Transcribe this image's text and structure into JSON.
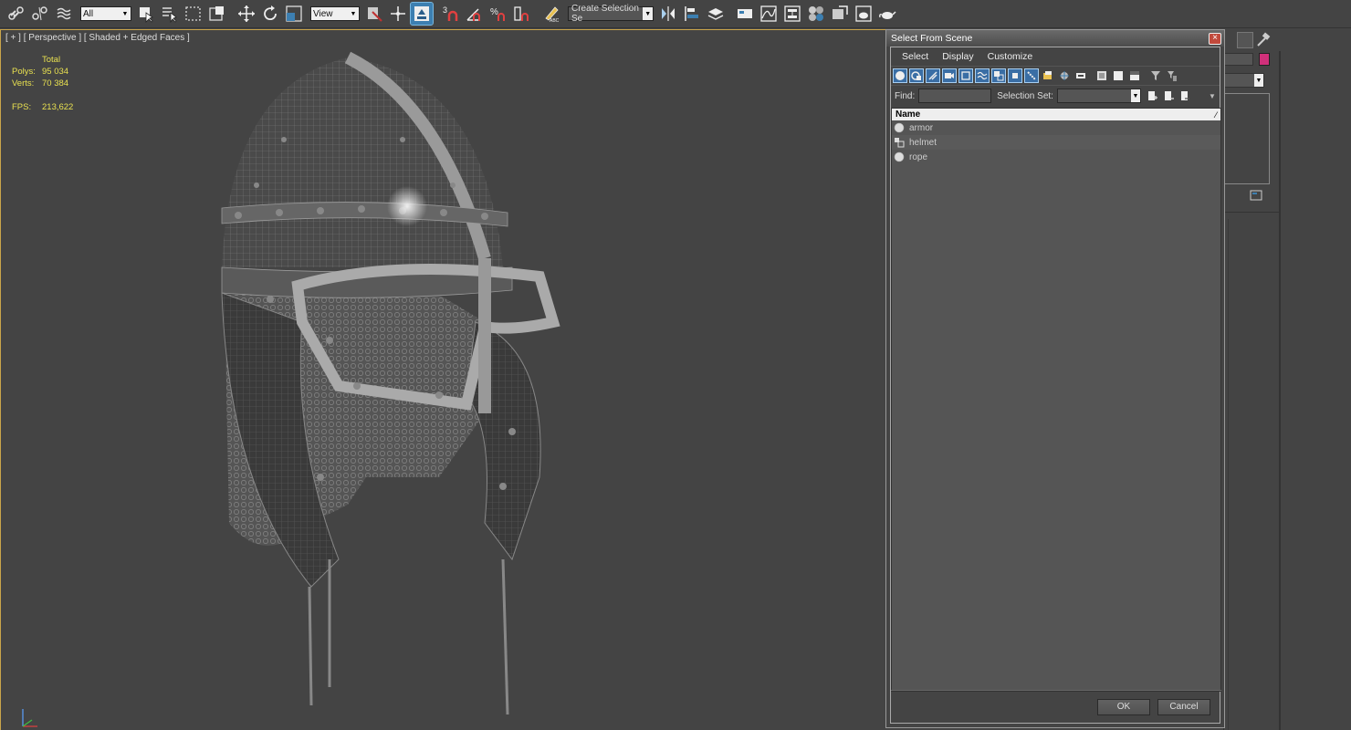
{
  "toolbar": {
    "selection_filter": "All",
    "reference_coord": "View",
    "named_selection_placeholder": "Create Selection Se",
    "snap_label": "3"
  },
  "viewport": {
    "label": "[ + ] [ Perspective ] [ Shaded + Edged Faces ]",
    "stats": {
      "total_label": "Total",
      "polys_label": "Polys:",
      "polys_value": "95 034",
      "verts_label": "Verts:",
      "verts_value": "70 384",
      "fps_label": "FPS:",
      "fps_value": "213,622"
    }
  },
  "dialog": {
    "title": "Select From Scene",
    "menu": [
      "Select",
      "Display",
      "Customize"
    ],
    "find_label": "Find:",
    "selection_set_label": "Selection Set:",
    "list_header": "Name",
    "items": [
      {
        "name": "armor",
        "icon": "geometry-sphere-icon"
      },
      {
        "name": "helmet",
        "icon": "group-icon"
      },
      {
        "name": "rope",
        "icon": "geometry-sphere-icon"
      }
    ],
    "ok_label": "OK",
    "cancel_label": "Cancel"
  },
  "colors": {
    "viewport_border": "#caa54a",
    "stats_text": "#e8e050",
    "active_button": "#3c7fb1",
    "accent_swatch": "#d0307a"
  }
}
